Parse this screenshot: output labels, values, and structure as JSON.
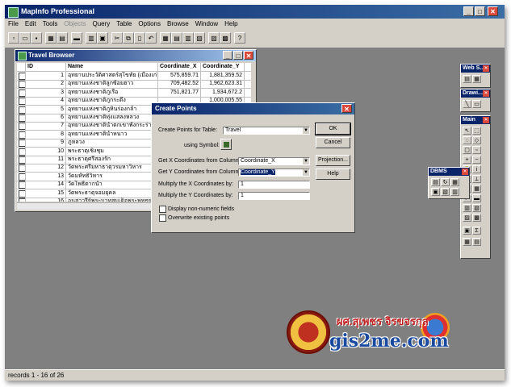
{
  "app": {
    "title": "MapInfo Professional"
  },
  "menu": [
    "File",
    "Edit",
    "Tools",
    "Objects",
    "Query",
    "Table",
    "Options",
    "Browse",
    "Window",
    "Help"
  ],
  "browser": {
    "title": "Travel Browser",
    "columns": [
      "ID",
      "Name",
      "Coordinate_X",
      "Coordinate_Y"
    ],
    "rows": [
      [
        "1",
        "อุทยานประวัติศาสตร์สุโขทัย (เมืองเก่าสุโขทัย)",
        "575,859.71",
        "1,881,359.52"
      ],
      [
        "2",
        "อุทยานแห่งชาติลูกซ้อยฮาว",
        "709,482.52",
        "1,962,623.31"
      ],
      [
        "3",
        "อุทยานแห่งชาติภูเรือ",
        "751,821.77",
        "1,934,672.2"
      ],
      [
        "4",
        "อุทยานแห่งชาติภูกระดึง",
        "",
        "1,000,005.55"
      ],
      [
        "5",
        "อุทยานแห่งชาติภูหินร่องกล้า",
        "",
        ""
      ],
      [
        "6",
        "อุทยานแห่งชาติทุ่งแสลงหลวง",
        "",
        ""
      ],
      [
        "7",
        "อุทยานแห่งชาติน้ำตกเขาพังกระร่าง",
        "",
        ""
      ],
      [
        "8",
        "อุทยานแห่งชาติน้ำหนาว",
        "",
        ""
      ],
      [
        "9",
        "ภูหลวง",
        "",
        ""
      ],
      [
        "10",
        "พระธาตุเชิงชุม",
        "",
        ""
      ],
      [
        "11",
        "พระธาตุศรีสองรัก",
        "",
        ""
      ],
      [
        "12",
        "วัดพระศรีมหาธาตุวรมหาวิหาร",
        "",
        ""
      ],
      [
        "13",
        "วัดมหัทธิวิหาร",
        "",
        ""
      ],
      [
        "14",
        "วัดโพธิ์ตากน้ำ",
        "",
        ""
      ],
      [
        "15",
        "วัดพระธาตุจอมยุคล",
        "",
        ""
      ],
      [
        "16",
        "อนุสาวรีย์พระบาทสมเด็จพระพุทธยอดฟ้า",
        "",
        ""
      ]
    ]
  },
  "dialog": {
    "title": "Create Points",
    "table_label": "Create Points for Table:",
    "table_value": "Travel",
    "symbol_label": "using Symbol:",
    "x_label": "Get X Coordinates from Column:",
    "x_value": "Coordinate_X",
    "y_label": "Get Y Coordinates from Column:",
    "y_value": "Coordinate_Y",
    "mx_label": "Multiply the X Coordinates by:",
    "mx_value": "1",
    "my_label": "Multiply the Y Coordinates by:",
    "my_value": "1",
    "cb1_label": "Display non-numeric fields",
    "cb2_label": "Overwrite existing points",
    "ok": "OK",
    "cancel": "Cancel",
    "projection": "Projection...",
    "help": "Help"
  },
  "palettes": {
    "web": "Web S...",
    "drawing": "Drawi...",
    "main": "Main",
    "dbms": "DBMS"
  },
  "status": "records 1 - 16 of 26",
  "branding": {
    "site": "gis2me.com",
    "name": "ผศ.สุเพชร จิรขจรกุล",
    "uni": "NARESUAN UNIVERSITY"
  }
}
